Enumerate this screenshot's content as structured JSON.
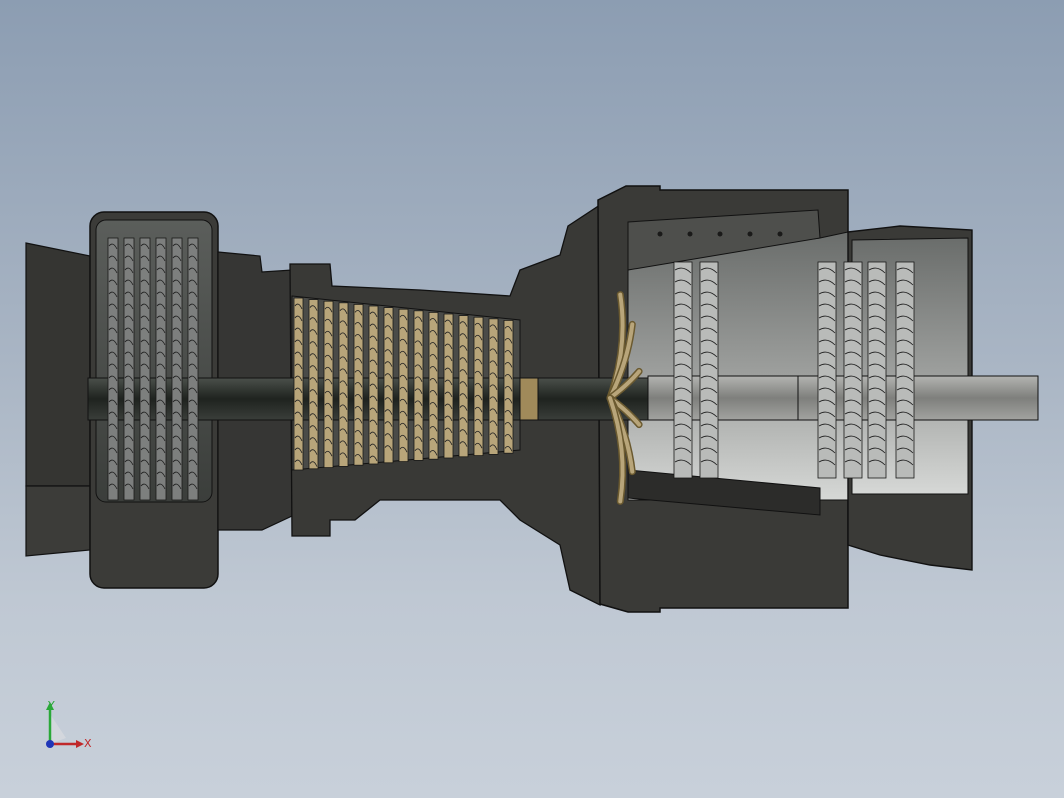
{
  "viewport": {
    "background_top": "#8c9db2",
    "background_bottom": "#c8d0da"
  },
  "model": {
    "housing_color": "#3a3a37",
    "housing_edge_color": "#111111",
    "shaft_color": "#2b2f2b",
    "shaft_light_color": "#8e8f8c",
    "compressor_blade_color": "#b8a57a",
    "turbine_blade_color": "#b9bbb9",
    "fan_blade_color": "#7d7f7e"
  },
  "triad": {
    "x_label": "X",
    "y_label": "Y",
    "x_color": "#c0282a",
    "y_color": "#2aa838",
    "z_color": "#2036b8"
  }
}
